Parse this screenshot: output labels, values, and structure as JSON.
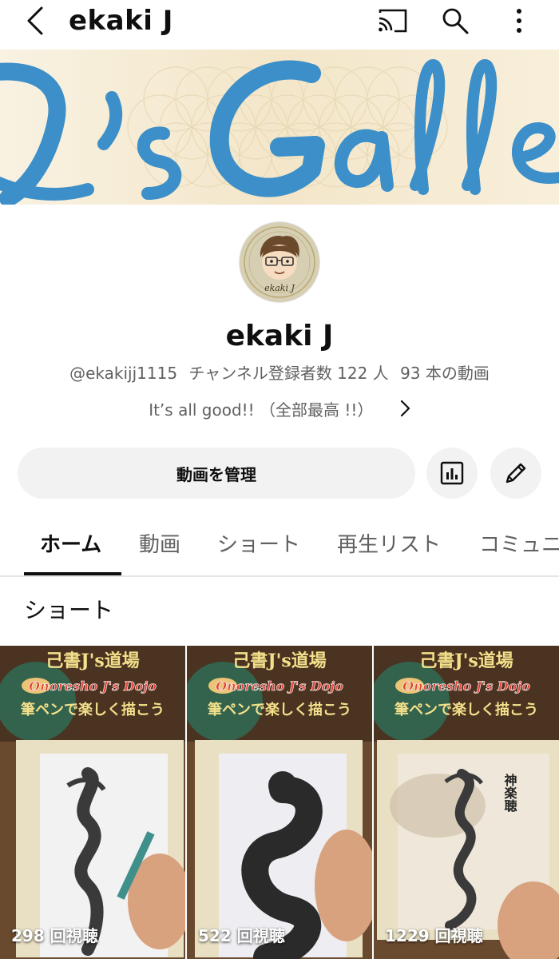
{
  "header": {
    "title": "ekaki J",
    "icons": [
      "back-arrow-icon",
      "cast-icon",
      "search-icon",
      "more-vert-icon"
    ]
  },
  "banner": {
    "text": "J's Gallery",
    "text_color": "#3c8fc8",
    "background": "#f6ecd7"
  },
  "avatar": {
    "label": "ekaki J"
  },
  "channel": {
    "name": "ekaki J",
    "handle": "@ekakijj1115",
    "subscribers": "チャンネル登録者数 122 人",
    "video_count": "93 本の動画",
    "description": "It’s all good!! （全部最高 !!）"
  },
  "actions": {
    "manage_label": "動画を管理",
    "stats_icon": "analytics-icon",
    "edit_icon": "edit-pencil-icon"
  },
  "tabs": [
    {
      "label": "ホーム",
      "active": true
    },
    {
      "label": "動画",
      "active": false
    },
    {
      "label": "ショート",
      "active": false
    },
    {
      "label": "再生リスト",
      "active": false
    },
    {
      "label": "コミュニ",
      "active": false
    }
  ],
  "shorts": {
    "section_title": "ショート",
    "items": [
      {
        "views": "298 回視聴",
        "overlay_title": "己書J's道場",
        "overlay_subtitle": "Onoresho J's Dojo",
        "overlay_caption": "筆ペンで楽しく描こう"
      },
      {
        "views": "522 回視聴",
        "overlay_title": "己書J's道場",
        "overlay_subtitle": "Onoresho J's Dojo",
        "overlay_caption": "筆ペンで楽しく描こう"
      },
      {
        "views": "1229 回視聴",
        "overlay_title": "己書J's道場",
        "overlay_subtitle": "Onoresho J's Dojo",
        "overlay_caption": "筆ペンで楽しく描こう",
        "art_text": "神楽聴"
      }
    ]
  },
  "colors": {
    "text_primary": "#0f0f0f",
    "text_secondary": "#606060",
    "chip_background": "#f2f2f2",
    "divider": "#e5e5e5"
  }
}
